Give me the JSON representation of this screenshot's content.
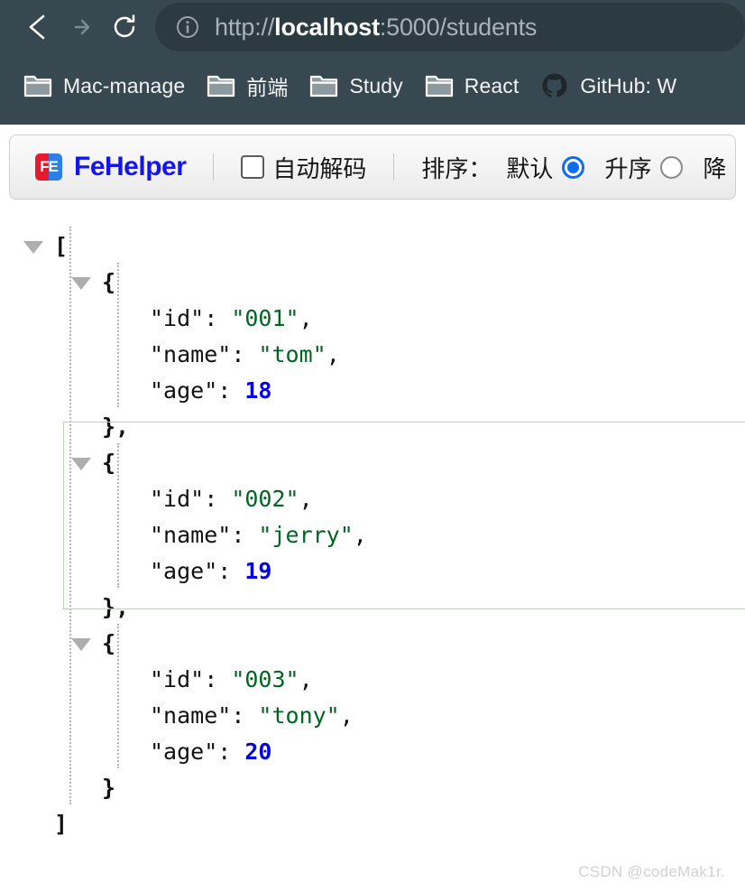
{
  "browser": {
    "nav": {
      "back_label": "Back",
      "forward_label": "Forward",
      "reload_label": "Reload"
    },
    "omnibox": {
      "info_icon": "info-circle-icon",
      "url_scheme": "http://",
      "url_host": "localhost",
      "url_rest": ":5000/students",
      "full_url": "http://localhost:5000/students"
    },
    "bookmarks": [
      {
        "icon": "folder-icon",
        "label": "Mac-manage"
      },
      {
        "icon": "folder-icon",
        "label": "前端"
      },
      {
        "icon": "folder-icon",
        "label": "Study"
      },
      {
        "icon": "folder-icon",
        "label": "React"
      },
      {
        "icon": "github-icon",
        "label": "GitHub: W"
      }
    ]
  },
  "fehelper": {
    "logo_text": "FE",
    "brand": "FeHelper",
    "auto_decode": {
      "label": "自动解码",
      "checked": false
    },
    "sort": {
      "label": "排序：",
      "options": [
        {
          "label": "默认",
          "selected": true
        },
        {
          "label": "升序",
          "selected": false
        }
      ],
      "truncated_option": "降"
    }
  },
  "json_viewer": {
    "lines": [
      {
        "indent": 0,
        "caret": true,
        "tokens": [
          {
            "t": "punct",
            "v": "["
          }
        ]
      },
      {
        "indent": 1,
        "caret": true,
        "tokens": [
          {
            "t": "punct",
            "v": "{"
          }
        ]
      },
      {
        "indent": 2,
        "caret": false,
        "tokens": [
          {
            "t": "key",
            "v": "\"id\""
          },
          {
            "t": "plain",
            "v": ": "
          },
          {
            "t": "str",
            "v": "\"001\""
          },
          {
            "t": "plain",
            "v": ","
          }
        ]
      },
      {
        "indent": 2,
        "caret": false,
        "tokens": [
          {
            "t": "key",
            "v": "\"name\""
          },
          {
            "t": "plain",
            "v": ": "
          },
          {
            "t": "str",
            "v": "\"tom\""
          },
          {
            "t": "plain",
            "v": ","
          }
        ]
      },
      {
        "indent": 2,
        "caret": false,
        "tokens": [
          {
            "t": "key",
            "v": "\"age\""
          },
          {
            "t": "plain",
            "v": ": "
          },
          {
            "t": "num",
            "v": "18"
          }
        ]
      },
      {
        "indent": 1,
        "caret": false,
        "tokens": [
          {
            "t": "punct",
            "v": "},"
          }
        ]
      },
      {
        "indent": 1,
        "caret": true,
        "tokens": [
          {
            "t": "punct",
            "v": "{"
          }
        ]
      },
      {
        "indent": 2,
        "caret": false,
        "tokens": [
          {
            "t": "key",
            "v": "\"id\""
          },
          {
            "t": "plain",
            "v": ": "
          },
          {
            "t": "str",
            "v": "\"002\""
          },
          {
            "t": "plain",
            "v": ","
          }
        ]
      },
      {
        "indent": 2,
        "caret": false,
        "tokens": [
          {
            "t": "key",
            "v": "\"name\""
          },
          {
            "t": "plain",
            "v": ": "
          },
          {
            "t": "str",
            "v": "\"jerry\""
          },
          {
            "t": "plain",
            "v": ","
          }
        ]
      },
      {
        "indent": 2,
        "caret": false,
        "tokens": [
          {
            "t": "key",
            "v": "\"age\""
          },
          {
            "t": "plain",
            "v": ": "
          },
          {
            "t": "num",
            "v": "19"
          }
        ]
      },
      {
        "indent": 1,
        "caret": false,
        "tokens": [
          {
            "t": "punct",
            "v": "},"
          }
        ]
      },
      {
        "indent": 1,
        "caret": true,
        "tokens": [
          {
            "t": "punct",
            "v": "{"
          }
        ]
      },
      {
        "indent": 2,
        "caret": false,
        "tokens": [
          {
            "t": "key",
            "v": "\"id\""
          },
          {
            "t": "plain",
            "v": ": "
          },
          {
            "t": "str",
            "v": "\"003\""
          },
          {
            "t": "plain",
            "v": ","
          }
        ]
      },
      {
        "indent": 2,
        "caret": false,
        "tokens": [
          {
            "t": "key",
            "v": "\"name\""
          },
          {
            "t": "plain",
            "v": ": "
          },
          {
            "t": "str",
            "v": "\"tony\""
          },
          {
            "t": "plain",
            "v": ","
          }
        ]
      },
      {
        "indent": 2,
        "caret": false,
        "tokens": [
          {
            "t": "key",
            "v": "\"age\""
          },
          {
            "t": "plain",
            "v": ": "
          },
          {
            "t": "num",
            "v": "20"
          }
        ]
      },
      {
        "indent": 1,
        "caret": false,
        "tokens": [
          {
            "t": "punct",
            "v": "}"
          }
        ]
      },
      {
        "indent": 0,
        "caret": false,
        "tokens": [
          {
            "t": "punct",
            "v": "]"
          }
        ]
      }
    ],
    "highlight_lines": [
      6,
      10
    ],
    "colors": {
      "string": "#006622",
      "number": "#0000e0",
      "key": "#111111",
      "highlight_border": "#b9d4b5",
      "caret": "#aeaeae"
    }
  },
  "watermark": "CSDN @codeMak1r."
}
